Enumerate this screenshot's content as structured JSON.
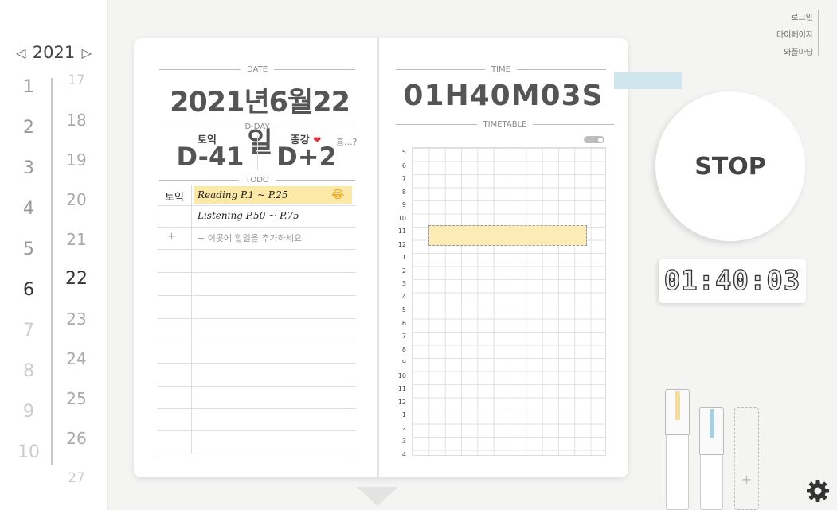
{
  "calendar": {
    "year": "2021",
    "prev_arrow": "◁",
    "next_arrow": "▷",
    "months": [
      "1",
      "2",
      "3",
      "4",
      "5",
      "6",
      "7",
      "8",
      "9",
      "10"
    ],
    "days": [
      "17",
      "18",
      "19",
      "20",
      "21",
      "22",
      "23",
      "24",
      "25",
      "26",
      "27"
    ],
    "selected_month": "6",
    "selected_day": "22"
  },
  "nav": {
    "login": "로그인",
    "mypage": "마이페이지",
    "wapple": "와플마당"
  },
  "left_page": {
    "date_label": "DATE",
    "date_value": "2021년6월22일",
    "dday_label": "D-DAY",
    "ddays": [
      {
        "name": "토익",
        "value": "D-41"
      },
      {
        "name": "종강",
        "value": "D+2",
        "emoji": "❤"
      }
    ],
    "dday_more": "흠...?",
    "todo_label": "TODO",
    "todo_category": "토익",
    "todos": [
      {
        "text": "Reading P.1 ~ P.25",
        "emoji": "😂"
      },
      {
        "text": "Listening P.50 ~ P.75"
      }
    ],
    "add_plus": "+",
    "add_placeholder": "+ 이곳에 할일을 추가하세요"
  },
  "right_page": {
    "time_label": "TIME",
    "time_value": "01H40M03S",
    "timetable_label": "TIMETABLE",
    "hours": [
      "5",
      "6",
      "7",
      "8",
      "9",
      "10",
      "11",
      "12",
      "1",
      "2",
      "3",
      "4",
      "5",
      "6",
      "7",
      "8",
      "9",
      "10",
      "11",
      "12",
      "1",
      "2",
      "3",
      "4"
    ]
  },
  "timer": {
    "stop_label": "STOP",
    "lcd_value": "01:40:03"
  },
  "pens": {
    "add_label": "+"
  },
  "colors": {
    "highlight": "#fde9a7",
    "tape": "#cfe6ee",
    "pen_yellow": "#f3dca0",
    "pen_blue": "#a9d0dc",
    "heart": "#e0303a"
  }
}
